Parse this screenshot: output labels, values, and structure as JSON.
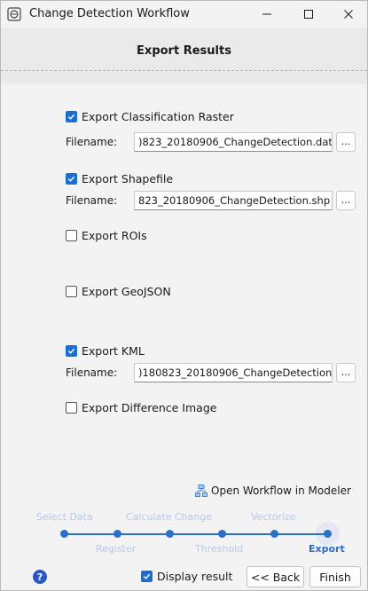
{
  "window": {
    "title": "Change Detection Workflow",
    "minimize_glyph": "—",
    "maximize_glyph": "☐",
    "close_glyph": "✕"
  },
  "page_title": "Export Results",
  "options": [
    {
      "label": "Export Classification Raster",
      "checked": true,
      "filename": ")823_20180906_ChangeDetection.dat"
    },
    {
      "label": "Export Shapefile",
      "checked": true,
      "filename": "823_20180906_ChangeDetection.shp"
    },
    {
      "label": "Export ROIs",
      "checked": false
    },
    {
      "label": "Export GeoJSON",
      "checked": false
    },
    {
      "label": "Export KML",
      "checked": true,
      "filename": ")180823_20180906_ChangeDetection"
    },
    {
      "label": "Export Difference Image",
      "checked": false
    }
  ],
  "filename_label": "Filename:",
  "browse_label": "...",
  "modeler_link": "Open Workflow in Modeler",
  "wizard": {
    "top_steps": [
      "Select Data",
      "Calculate Change",
      "Vectorize"
    ],
    "bottom_steps": [
      "Register",
      "Threshold",
      "Export"
    ],
    "active_step": "Export"
  },
  "footer": {
    "help_glyph": "?",
    "display_result_label": "Display result",
    "display_result_checked": true,
    "back_label": "<< Back",
    "finish_label": "Finish"
  },
  "colors": {
    "accent": "#1a6fd0",
    "wizard_inactive": "#b7c8e8",
    "wizard_active": "#2a6fc9"
  }
}
